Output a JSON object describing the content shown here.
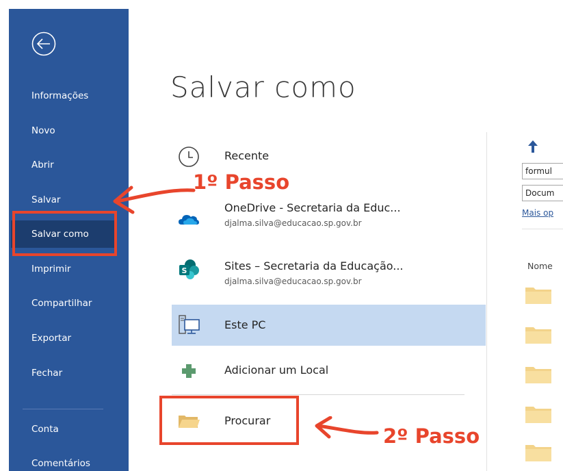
{
  "window": {
    "title": "Salvar como"
  },
  "sidebar": {
    "items": [
      {
        "label": "Informações"
      },
      {
        "label": "Novo"
      },
      {
        "label": "Abrir"
      },
      {
        "label": "Salvar"
      },
      {
        "label": "Salvar como",
        "selected": true
      },
      {
        "label": "Imprimir"
      },
      {
        "label": "Compartilhar"
      },
      {
        "label": "Exportar"
      },
      {
        "label": "Fechar"
      },
      {
        "label": "Conta"
      },
      {
        "label": "Comentários"
      }
    ]
  },
  "locations": [
    {
      "name": "Recente",
      "icon": "clock-icon"
    },
    {
      "name": "OneDrive - Secretaria da Educ...",
      "sub": "djalma.silva@educacao.sp.gov.br",
      "icon": "onedrive-cloud-icon"
    },
    {
      "name": "Sites – Secretaria da Educação...",
      "sub": "djalma.silva@educacao.sp.gov.br",
      "icon": "sharepoint-icon"
    },
    {
      "name": "Este PC",
      "icon": "computer-icon",
      "selected": true
    },
    {
      "name": "Adicionar um Local",
      "icon": "plus-icon"
    },
    {
      "name": "Procurar",
      "icon": "folder-open-icon"
    }
  ],
  "right_panel": {
    "filename_value": "formul",
    "filetype_value": "Docum",
    "more_options": "Mais op",
    "name_column": "Nome"
  },
  "annotations": {
    "step1": "1º Passo",
    "step2": "2º Passo"
  },
  "colors": {
    "sidebar_bg": "#2b579a",
    "sidebar_selected": "#1c3d6e",
    "location_selected": "#c5d9f1",
    "annotation": "#e8452c"
  }
}
